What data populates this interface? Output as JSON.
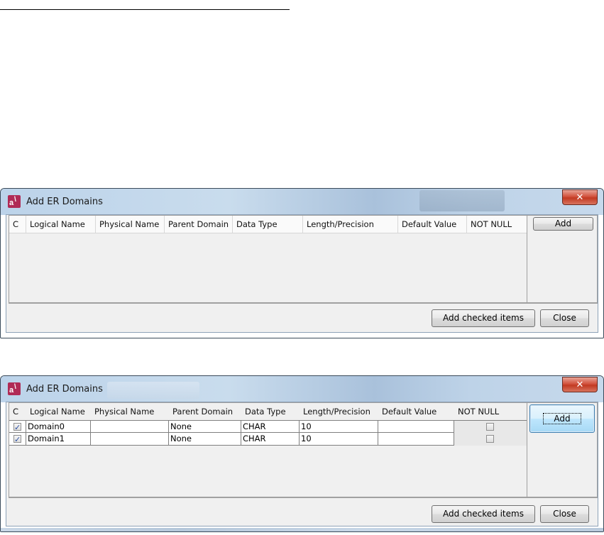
{
  "dialogs": [
    {
      "title": "Add ER Domains",
      "close_icon": "close-x-icon",
      "columns": [
        "C",
        "Logical Name",
        "Physical Name",
        "Parent Domain",
        "Data Type",
        "Length/Precision",
        "Default Value",
        "NOT NULL"
      ],
      "rows": [],
      "add_label": "Add",
      "add_checked_label": "Add checked items",
      "close_label": "Close"
    },
    {
      "title": "Add ER Domains",
      "close_icon": "close-x-icon",
      "columns": [
        "C",
        "Logical Name",
        "Physical Name",
        "Parent Domain",
        "Data Type",
        "Length/Precision",
        "Default Value",
        "NOT NULL"
      ],
      "rows": [
        {
          "checked": true,
          "logical_name": "Domain0",
          "physical_name": "",
          "parent_domain": "None",
          "data_type": "CHAR",
          "length": "10",
          "default_value": "",
          "not_null": false
        },
        {
          "checked": true,
          "logical_name": "Domain1",
          "physical_name": "",
          "parent_domain": "None",
          "data_type": "CHAR",
          "length": "10",
          "default_value": "",
          "not_null": false
        }
      ],
      "add_label": "Add",
      "add_checked_label": "Add checked items",
      "close_label": "Close"
    }
  ]
}
